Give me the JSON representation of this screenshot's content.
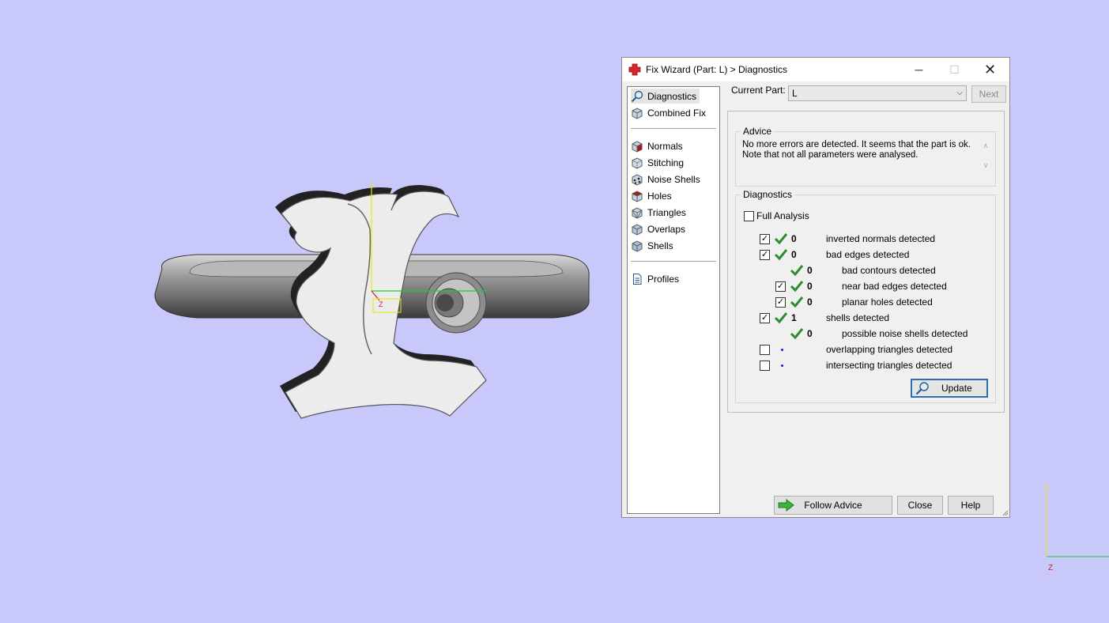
{
  "window": {
    "title": "Fix Wizard (Part: L) > Diagnostics",
    "minimize_glyph": "─",
    "maximize_glyph": "☐",
    "close_glyph": "✕"
  },
  "nav": {
    "group1": [
      {
        "label": "Diagnostics",
        "icon": "magnifier-icon",
        "selected": true
      },
      {
        "label": "Combined Fix",
        "icon": "cube-icon"
      }
    ],
    "group2": [
      {
        "label": "Normals",
        "icon": "normals-cube-icon"
      },
      {
        "label": "Stitching",
        "icon": "stitching-cube-icon"
      },
      {
        "label": "Noise Shells",
        "icon": "noise-shells-cube-icon"
      },
      {
        "label": "Holes",
        "icon": "holes-cube-icon"
      },
      {
        "label": "Triangles",
        "icon": "triangles-cube-icon"
      },
      {
        "label": "Overlaps",
        "icon": "overlaps-cube-icon"
      },
      {
        "label": "Shells",
        "icon": "shells-cube-icon"
      }
    ],
    "group3": [
      {
        "label": "Profiles",
        "icon": "document-icon"
      }
    ]
  },
  "current_part": {
    "label": "Current Part:",
    "value": "L",
    "next_label": "Next"
  },
  "advice": {
    "title": "Advice",
    "line1": "No more errors are detected. It seems that the part is ok.",
    "line2": "Note that not all parameters were analysed.",
    "scroll_up": "∧",
    "scroll_down": "∨"
  },
  "diagnostics": {
    "title": "Diagnostics",
    "full_analysis_label": "Full Analysis",
    "full_analysis_checked": false,
    "rows": [
      {
        "checkbox": true,
        "checked": true,
        "status": "ok",
        "count": "0",
        "label": "inverted normals detected",
        "indent": 0
      },
      {
        "checkbox": true,
        "checked": true,
        "status": "ok",
        "count": "0",
        "label": "bad edges detected",
        "indent": 0
      },
      {
        "checkbox": false,
        "checked": false,
        "status": "ok",
        "count": "0",
        "label": "bad contours detected",
        "indent": 1
      },
      {
        "checkbox": true,
        "checked": true,
        "status": "ok",
        "count": "0",
        "label": "near bad edges detected",
        "indent": 1
      },
      {
        "checkbox": true,
        "checked": true,
        "status": "ok",
        "count": "0",
        "label": "planar holes detected",
        "indent": 1
      },
      {
        "checkbox": true,
        "checked": true,
        "status": "ok",
        "count": "1",
        "label": "shells detected",
        "indent": 0
      },
      {
        "checkbox": false,
        "checked": false,
        "status": "ok",
        "count": "0",
        "label": "possible noise shells detected",
        "indent": 1
      },
      {
        "checkbox": true,
        "checked": false,
        "status": "pending",
        "count": "",
        "label": "overlapping triangles detected",
        "indent": 0
      },
      {
        "checkbox": true,
        "checked": false,
        "status": "pending",
        "count": "",
        "label": "intersecting triangles detected",
        "indent": 0
      }
    ],
    "update_label": "Update"
  },
  "footer": {
    "follow_advice_label": "Follow Advice",
    "close_label": "Close",
    "help_label": "Help"
  },
  "viewport": {
    "model": "letter-L-ring",
    "axis_labels": {
      "y": "Y",
      "z": "Z"
    }
  },
  "colors": {
    "viewport_bg": "#c8c8fb",
    "tick_green": "#2e8b2e",
    "follow_arrow_green": "#3cb43c",
    "title_icon_red": "#d8252c",
    "focus_blue": "#2b6fb5"
  }
}
